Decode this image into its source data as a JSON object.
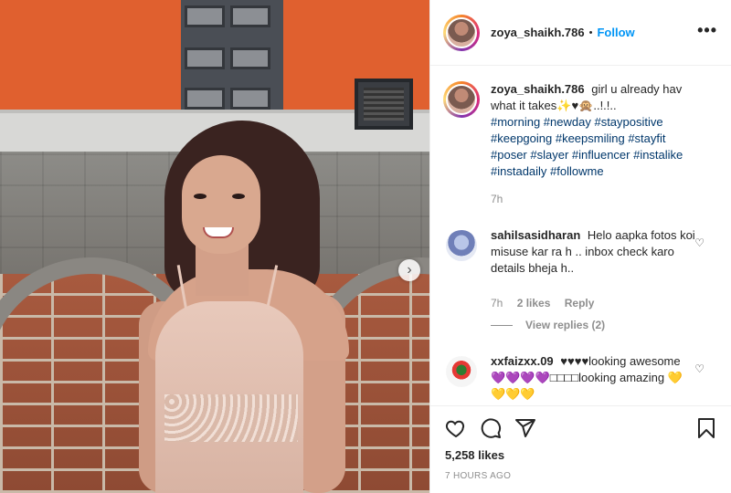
{
  "post": {
    "username": "zoya_shaikh.786",
    "separator": "•",
    "follow_label": "Follow",
    "more_label": "•••",
    "caption_text": "girl u already hav what it takes✨♥🙊..!.!..",
    "caption_tags": "#morning #newday #staypositive #keepgoing #keepsmiling #stayfit #poser #slayer #influencer #instalike #instadaily #followme",
    "caption_time": "7h",
    "carousel_next": "›"
  },
  "comments": [
    {
      "username": "sahilsasidharan",
      "text": "Helo aapka fotos koi misuse kar ra h .. inbox check karo details bheja h..",
      "time": "7h",
      "likes": "2 likes",
      "reply_label": "Reply",
      "view_replies": "View replies (2)"
    },
    {
      "username": "xxfaizxx.09",
      "text": "♥♥♥♥looking awesome 💜💜💜💜□□□□looking amazing 💛💛💛💛"
    }
  ],
  "footer": {
    "likes": "5,258 likes",
    "ago": "7 HOURS AGO"
  },
  "icons": {
    "heart": "heart-icon",
    "comment": "comment-icon",
    "share": "share-icon",
    "save": "bookmark-icon"
  },
  "colors": {
    "link": "#0095f6",
    "hashtag": "#00376b",
    "muted": "#8e8e8e"
  }
}
